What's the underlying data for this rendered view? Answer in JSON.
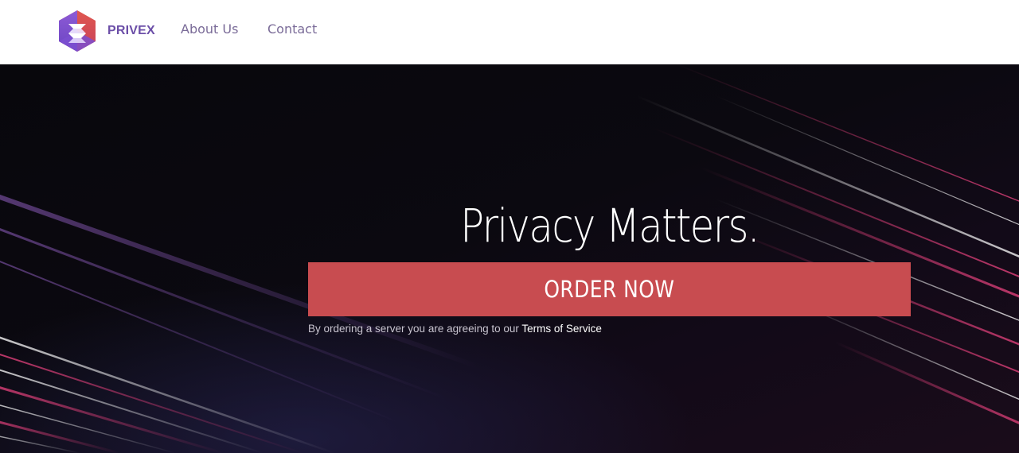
{
  "brand": {
    "name": "PRIVEX",
    "color": "#6c4fa8",
    "logo_icon": "hexagon-logo-icon"
  },
  "nav": {
    "links": [
      {
        "label": "About Us"
      },
      {
        "label": "Contact"
      }
    ],
    "link_color": "#7a6b98"
  },
  "hero": {
    "title": "Privacy Matters.",
    "order_button": "ORDER NOW",
    "button_color": "#c84c50",
    "disclaimer_prefix": "By ordering a server you are agreeing to our ",
    "terms_link": "Terms of Service",
    "background": "dark streaked lines"
  }
}
